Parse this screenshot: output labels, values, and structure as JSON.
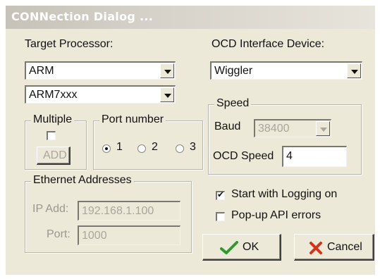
{
  "window": {
    "title": "CONNection Dialog ..."
  },
  "target_processor": {
    "label": "Target Processor:",
    "family": "ARM",
    "core": "ARM7xxx"
  },
  "ocd_interface": {
    "label": "OCD Interface Device:",
    "device": "Wiggler"
  },
  "multiple": {
    "label": "Multiple",
    "checked": false,
    "add_label": "ADD"
  },
  "port_number": {
    "label": "Port number",
    "options": [
      "1",
      "2",
      "3"
    ],
    "selected": "1"
  },
  "speed": {
    "label": "Speed",
    "baud_label": "Baud",
    "baud_value": "38400",
    "ocd_speed_label": "OCD Speed",
    "ocd_speed_value": "4"
  },
  "ethernet": {
    "label": "Ethernet Addresses",
    "ip_label": "IP Add:",
    "ip_value": "192.168.1.100",
    "port_label": "Port:",
    "port_value": "1000"
  },
  "options": {
    "logging_label": "Start with Logging on",
    "logging_checked": true,
    "popup_label": "Pop-up API errors",
    "popup_checked": false
  },
  "buttons": {
    "ok_label": "OK",
    "cancel_label": "Cancel"
  },
  "colors": {
    "ok_check": "#2e9a2e",
    "cancel_x": "#d2351b",
    "face": "#ece9d8"
  }
}
